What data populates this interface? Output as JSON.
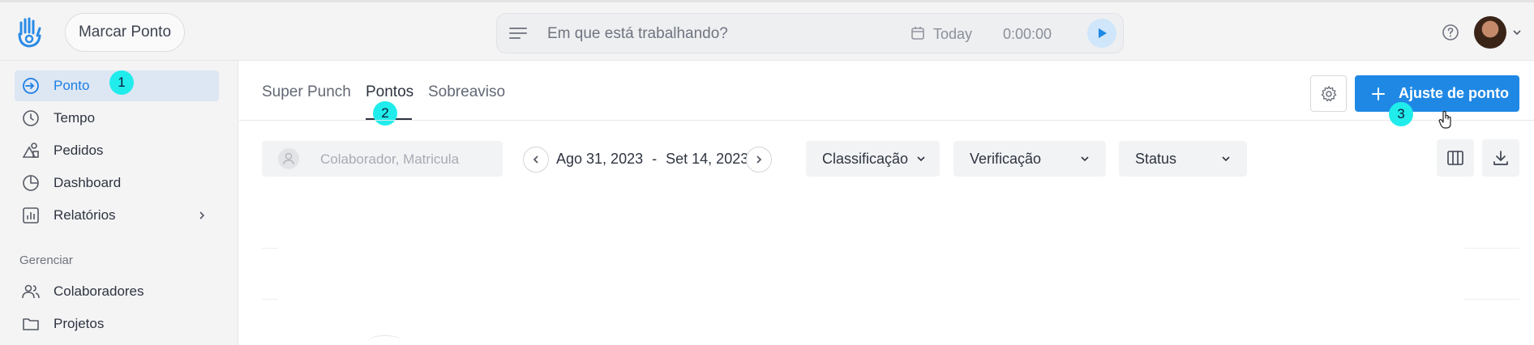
{
  "header": {
    "marcar_label": "Marcar Ponto",
    "tracker_placeholder": "Em que está trabalhando?",
    "date_label": "Today",
    "timer": "0:00:00"
  },
  "sidebar": {
    "items": [
      {
        "label": "Ponto",
        "icon": "arrow-in-circle-icon",
        "active": true
      },
      {
        "label": "Tempo",
        "icon": "clock-icon"
      },
      {
        "label": "Pedidos",
        "icon": "shapes-icon"
      },
      {
        "label": "Dashboard",
        "icon": "pie-chart-icon"
      },
      {
        "label": "Relatórios",
        "icon": "bar-chart-icon",
        "has_submenu": true
      }
    ],
    "section_label": "Gerenciar",
    "manage_items": [
      {
        "label": "Colaboradores",
        "icon": "users-icon"
      },
      {
        "label": "Projetos",
        "icon": "folder-icon"
      }
    ]
  },
  "tabs": [
    {
      "label": "Super Punch"
    },
    {
      "label": "Pontos",
      "active": true
    },
    {
      "label": "Sobreaviso"
    }
  ],
  "actions": {
    "add_label": "Ajuste de ponto"
  },
  "filters": {
    "search_placeholder": "Colaborador, Matricula",
    "date_start": "Ago 31, 2023",
    "date_sep": "-",
    "date_end": "Set 14, 2023",
    "classificacao": "Classificação",
    "verificacao": "Verificação",
    "status": "Status"
  },
  "annotations": [
    "1",
    "2",
    "3"
  ],
  "colors": {
    "accent": "#1f88e5",
    "active_bg": "#dde7f3",
    "badge": "#21ecec"
  }
}
